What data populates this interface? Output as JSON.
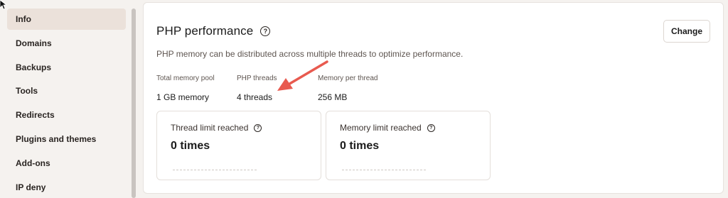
{
  "sidebar": {
    "items": [
      {
        "label": "Info",
        "active": true
      },
      {
        "label": "Domains",
        "active": false
      },
      {
        "label": "Backups",
        "active": false
      },
      {
        "label": "Tools",
        "active": false
      },
      {
        "label": "Redirects",
        "active": false
      },
      {
        "label": "Plugins and themes",
        "active": false
      },
      {
        "label": "Add-ons",
        "active": false
      },
      {
        "label": "IP deny",
        "active": false
      }
    ]
  },
  "panel": {
    "title": "PHP performance",
    "help_glyph": "?",
    "change_label": "Change",
    "description": "PHP memory can be distributed across multiple threads to optimize performance.",
    "stats": [
      {
        "label": "Total memory pool",
        "value": "1 GB memory"
      },
      {
        "label": "PHP threads",
        "value": "4 threads"
      },
      {
        "label": "Memory per thread",
        "value": "256 MB"
      }
    ],
    "cards": [
      {
        "title": "Thread limit reached",
        "value": "0 times"
      },
      {
        "title": "Memory limit reached",
        "value": "0 times"
      }
    ]
  },
  "colors": {
    "accent_arrow": "#e85a4f",
    "active_item_bg": "#ebe1da",
    "page_bg": "#f5f2ef"
  },
  "icons": {
    "help": "help-icon",
    "arrow": "annotation-arrow-icon",
    "cursor": "mouse-cursor-icon"
  }
}
